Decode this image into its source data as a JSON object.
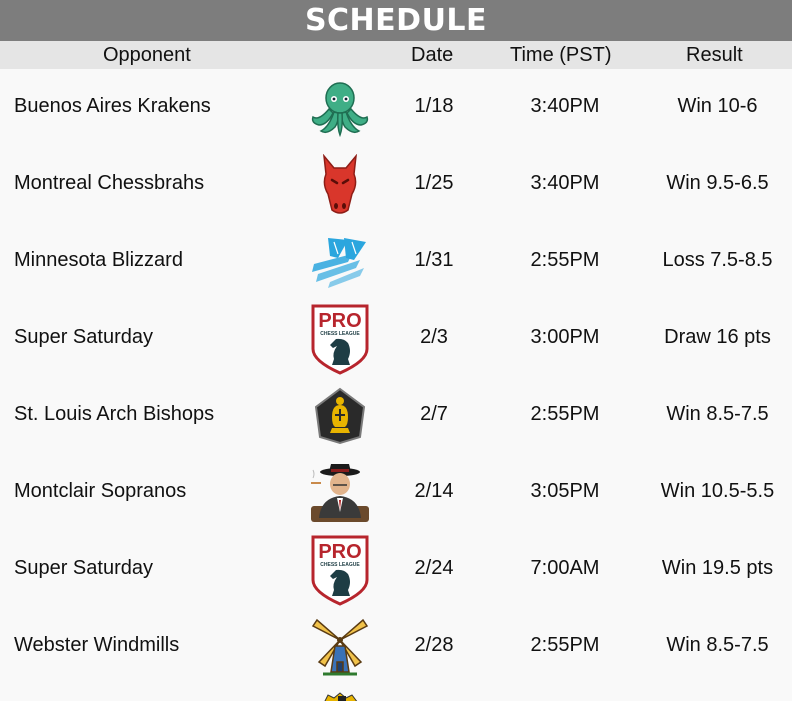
{
  "title": "SCHEDULE",
  "columns": {
    "opponent": "Opponent",
    "date": "Date",
    "time": "Time (PST)",
    "result": "Result"
  },
  "rows": [
    {
      "opponent": "Buenos Aires Krakens",
      "logo": "kraken-logo-icon",
      "date": "1/18",
      "time": "3:40PM",
      "result": "Win 10-6"
    },
    {
      "opponent": "Montreal Chessbrahs",
      "logo": "red-horse-logo-icon",
      "date": "1/25",
      "time": "3:40PM",
      "result": "Win 9.5-6.5"
    },
    {
      "opponent": "Minnesota Blizzard",
      "logo": "blizzard-logo-icon",
      "date": "1/31",
      "time": "2:55PM",
      "result": "Loss 7.5-8.5"
    },
    {
      "opponent": "Super Saturday",
      "logo": "pro-chess-league-shield-icon",
      "date": "2/3",
      "time": "3:00PM",
      "result": "Draw 16 pts"
    },
    {
      "opponent": "St. Louis Arch Bishops",
      "logo": "bishop-shield-logo-icon",
      "date": "2/7",
      "time": "2:55PM",
      "result": "Win 8.5-7.5"
    },
    {
      "opponent": "Montclair Sopranos",
      "logo": "mobster-logo-icon",
      "date": "2/14",
      "time": "3:05PM",
      "result": "Win 10.5-5.5"
    },
    {
      "opponent": "Super Saturday",
      "logo": "pro-chess-league-shield-icon",
      "date": "2/24",
      "time": "7:00AM",
      "result": "Win 19.5 pts"
    },
    {
      "opponent": "Webster Windmills",
      "logo": "windmill-logo-icon",
      "date": "2/28",
      "time": "2:55PM",
      "result": "Win 8.5-7.5"
    }
  ],
  "logo_text": {
    "pro": "PRO",
    "league": "CHESS LEAGUE"
  },
  "colors": {
    "title_bg": "#7d7d7d",
    "header_bg": "#e5e5e5",
    "page_bg": "#f9f9f9",
    "kraken": "#3fae86",
    "horse": "#d9362b",
    "blizzard": "#2ba6de",
    "pro_red": "#b7252d",
    "pro_teal": "#1e3d44"
  }
}
